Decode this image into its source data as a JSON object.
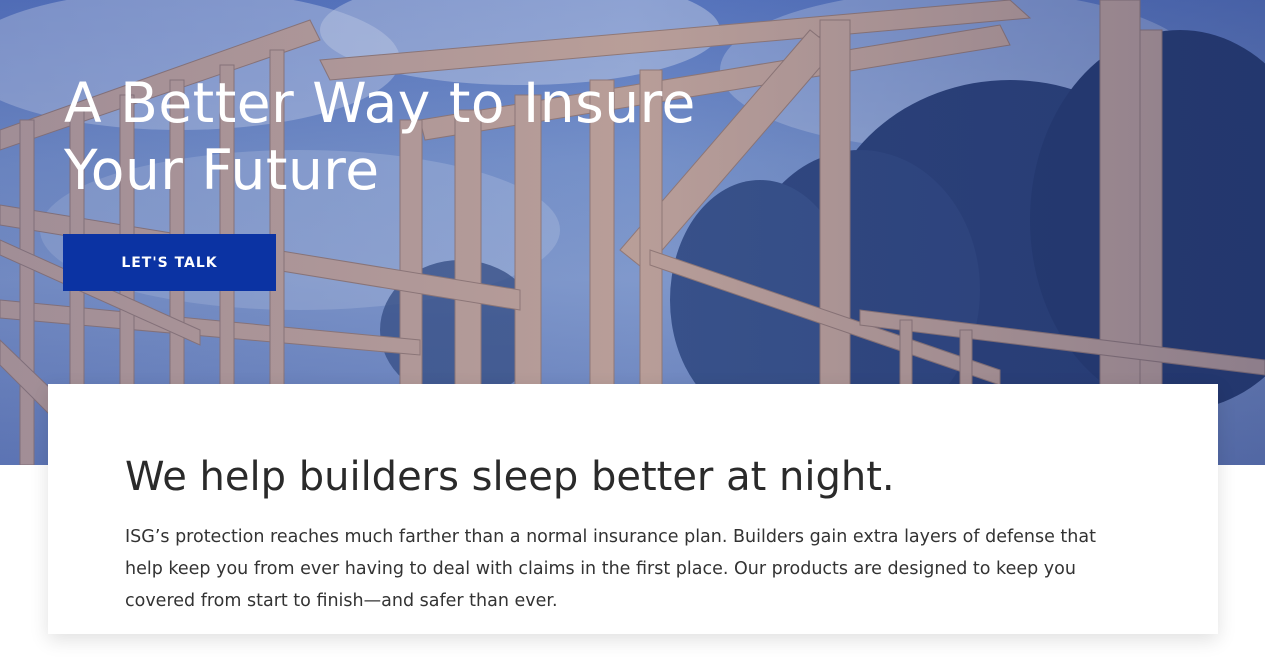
{
  "hero": {
    "title": "A Better Way to Insure Your Future",
    "cta_label": "LET'S TALK",
    "image_description": "wood-framing-construction-photo"
  },
  "intro": {
    "heading": "We help builders sleep better at night.",
    "body": "ISG’s protection reaches much farther than a normal insurance plan. Builders gain extra layers of defense that help keep you from ever having to deal with claims in the first place. Our products are designed to keep you covered from start to finish—and safer than ever."
  },
  "colors": {
    "cta_background": "#0b33a3",
    "heading_text": "#2a2a2a",
    "body_text": "#333333",
    "hero_text": "#ffffff"
  }
}
